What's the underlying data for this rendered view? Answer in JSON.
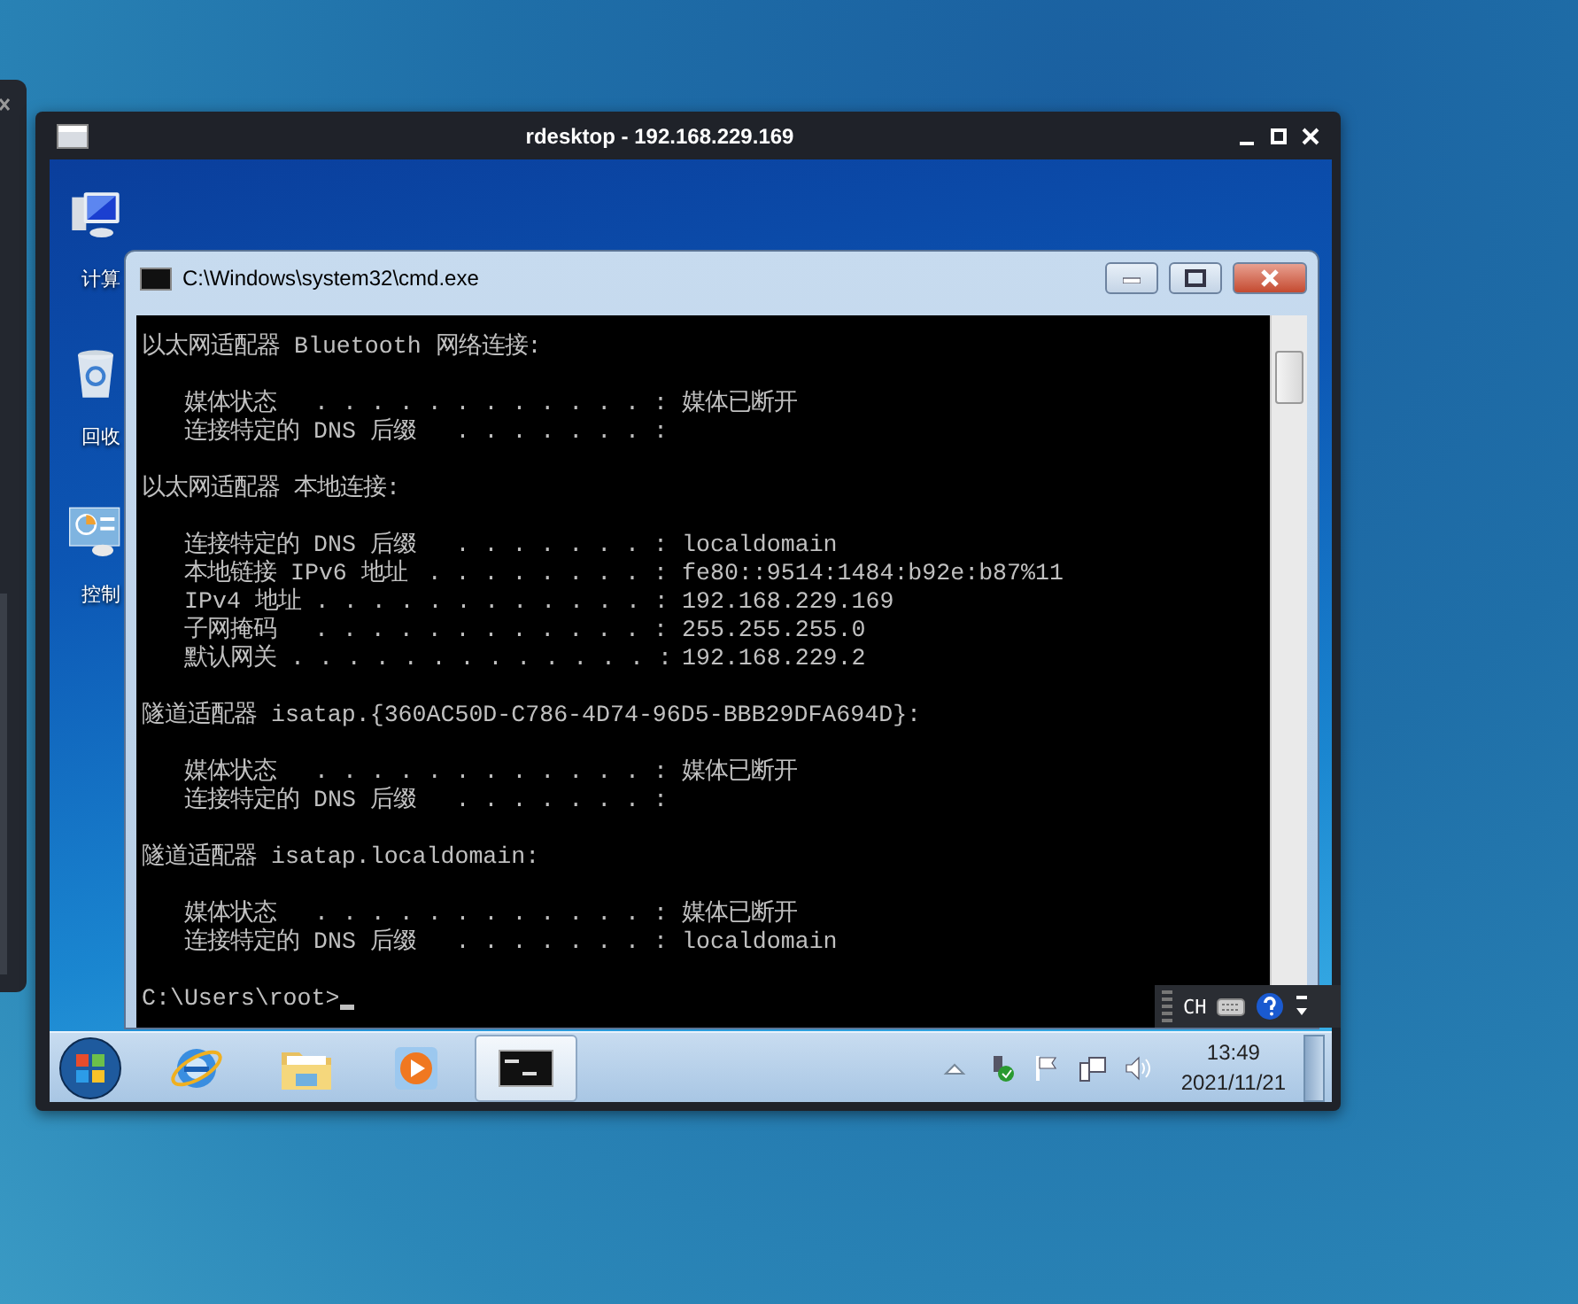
{
  "rdesktop": {
    "title": "rdesktop - 192.168.229.169"
  },
  "desktop_icons": [
    {
      "kind": "computer",
      "label": "计算"
    },
    {
      "kind": "recycle-bin",
      "label": "回收"
    },
    {
      "kind": "control-panel",
      "label": "控制"
    }
  ],
  "cmd": {
    "title": "C:\\Windows\\system32\\cmd.exe",
    "sections": [
      {
        "heading": "以太网适配器 Bluetooth 网络连接:",
        "entries": [
          {
            "label": "媒体状态",
            "leader": ". . . . . . . . . . . . :",
            "value": "媒体已断开"
          },
          {
            "label": "连接特定的 DNS 后缀",
            "leader": ". . . . . . . :"
          }
        ]
      },
      {
        "heading": "以太网适配器 本地连接:",
        "entries": [
          {
            "label": "连接特定的 DNS 后缀",
            "leader": ". . . . . . . :",
            "value": "localdomain"
          },
          {
            "label": "本地链接 IPv6 地址",
            "leader": ". . . . . . . . :",
            "value": "fe80::9514:1484:b92e:b87%11"
          },
          {
            "label": "IPv4 地址",
            "leader": ". . . . . . . . . . . . :",
            "value": "192.168.229.169"
          },
          {
            "label": "子网掩码",
            "leader": ". . . . . . . . . . . . :",
            "value": "255.255.255.0"
          },
          {
            "label": "默认网关",
            "leader": ". . . . . . . . . . . . . :",
            "value": "192.168.229.2"
          }
        ]
      },
      {
        "heading": "隧道适配器 isatap.{360AC50D-C786-4D74-96D5-BBB29DFA694D}:",
        "entries": [
          {
            "label": "媒体状态",
            "leader": ". . . . . . . . . . . . :",
            "value": "媒体已断开"
          },
          {
            "label": "连接特定的 DNS 后缀",
            "leader": ". . . . . . . :"
          }
        ]
      },
      {
        "heading": "隧道适配器 isatap.localdomain:",
        "entries": [
          {
            "label": "媒体状态",
            "leader": ". . . . . . . . . . . . :",
            "value": "媒体已断开"
          },
          {
            "label": "连接特定的 DNS 后缀",
            "leader": ". . . . . . . :",
            "value": "localdomain"
          }
        ]
      }
    ],
    "prompt": "C:\\Users\\root>"
  },
  "language_bar": {
    "label": "CH"
  },
  "taskbar": {
    "items": [
      {
        "kind": "browser",
        "selected": false
      },
      {
        "kind": "folder",
        "selected": false
      },
      {
        "kind": "media",
        "selected": false
      },
      {
        "kind": "console",
        "selected": true
      }
    ],
    "clock": {
      "time": "13:49",
      "date": "2021/11/21"
    }
  }
}
